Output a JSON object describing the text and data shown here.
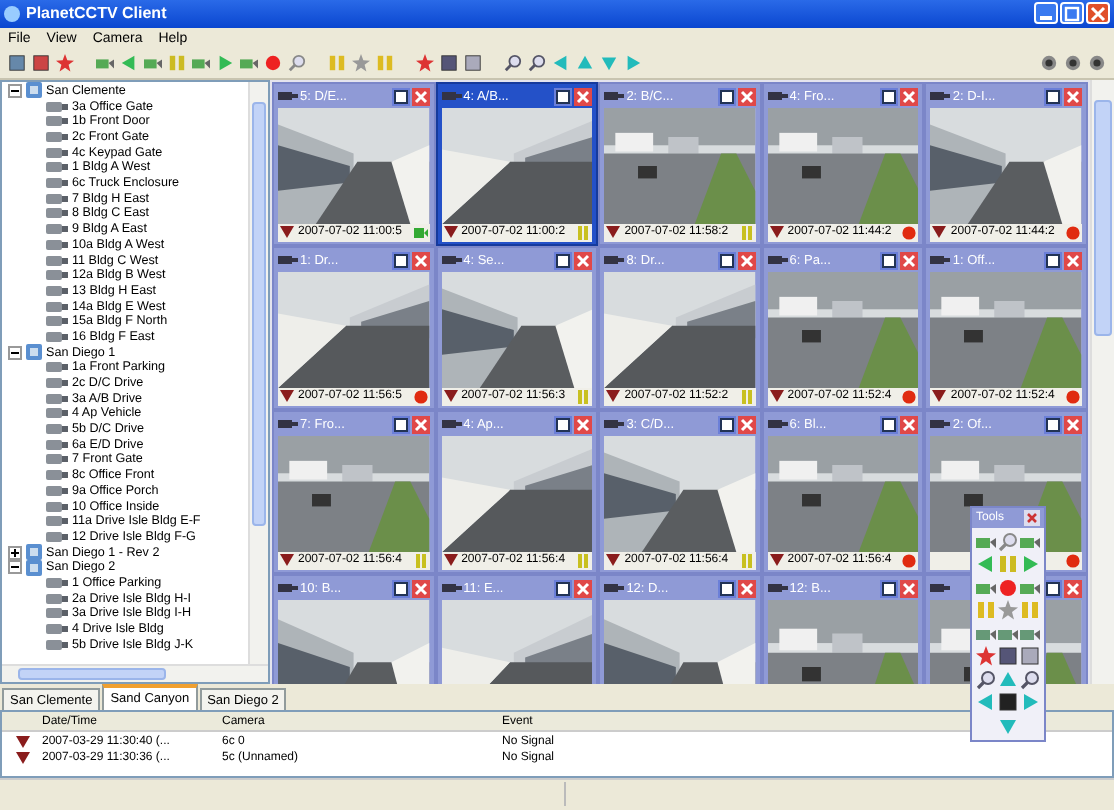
{
  "window": {
    "title": "PlanetCCTV Client"
  },
  "menu": [
    "File",
    "View",
    "Camera",
    "Help"
  ],
  "sites": [
    {
      "label": "San Clemente",
      "expanded": true,
      "children": [
        {
          "label": "3a Office Gate"
        },
        {
          "label": "1b Front Door"
        },
        {
          "label": "2c Front Gate"
        },
        {
          "label": "4c Keypad Gate"
        },
        {
          "label": "1 Bldg A West"
        },
        {
          "label": "6c Truck Enclosure"
        },
        {
          "label": "7 Bldg H East"
        },
        {
          "label": "8 Bldg C East"
        },
        {
          "label": "9 Bldg A East"
        },
        {
          "label": "10a Bldg A West"
        },
        {
          "label": "11 Bldg C West"
        },
        {
          "label": "12a Bldg B West"
        },
        {
          "label": "13 Bldg H East"
        },
        {
          "label": "14a Bldg E West"
        },
        {
          "label": "15a Bldg F North"
        },
        {
          "label": "16 Bldg F East"
        }
      ]
    },
    {
      "label": "San Diego 1",
      "expanded": true,
      "children": [
        {
          "label": "1a Front Parking"
        },
        {
          "label": "2c D/C Drive"
        },
        {
          "label": "3a A/B Drive"
        },
        {
          "label": "4 Ap Vehicle"
        },
        {
          "label": "5b D/C Drive"
        },
        {
          "label": "6a E/D Drive"
        },
        {
          "label": "7 Front Gate"
        },
        {
          "label": "8c Office Front"
        },
        {
          "label": "9a Office Porch"
        },
        {
          "label": "10 Office Inside"
        },
        {
          "label": "11a Drive Isle Bldg E-F"
        },
        {
          "label": "12 Drive Isle Bldg F-G"
        }
      ]
    },
    {
      "label": "San Diego 1 - Rev 2",
      "expanded": false
    },
    {
      "label": "San Diego 2",
      "expanded": true,
      "children": [
        {
          "label": "1 Office Parking"
        },
        {
          "label": "2a Drive Isle Bldg H-I"
        },
        {
          "label": "3a Drive Isle Bldg I-H"
        },
        {
          "label": "4 Drive Isle Bldg"
        },
        {
          "label": "5b Drive Isle Bldg J-K"
        }
      ]
    }
  ],
  "cameras": [
    {
      "title": "5: D/E...",
      "selected": false,
      "time": "2007-07-02 11:00:5",
      "recording": false,
      "paused": false
    },
    {
      "title": "4: A/B...",
      "selected": true,
      "time": "2007-07-02 11:00:2",
      "recording": false,
      "paused": true
    },
    {
      "title": "2: B/C...",
      "selected": false,
      "time": "2007-07-02 11:58:2",
      "recording": false,
      "paused": true
    },
    {
      "title": "4: Fro...",
      "selected": false,
      "time": "2007-07-02 11:44:2",
      "recording": true
    },
    {
      "title": "2: D-I...",
      "selected": false,
      "time": "2007-07-02 11:44:2",
      "recording": true
    },
    {
      "title": "1: Dr...",
      "selected": false,
      "time": "2007-07-02 11:56:5",
      "recording": true
    },
    {
      "title": "4: Se...",
      "selected": false,
      "time": "2007-07-02 11:56:3",
      "recording": false,
      "paused": true
    },
    {
      "title": "8: Dr...",
      "selected": false,
      "time": "2007-07-02 11:52:2",
      "recording": false,
      "paused": true
    },
    {
      "title": "6: Pa...",
      "selected": false,
      "time": "2007-07-02 11:52:4",
      "recording": true
    },
    {
      "title": "1: Off...",
      "selected": false,
      "time": "2007-07-02 11:52:4",
      "recording": true
    },
    {
      "title": "7: Fro...",
      "selected": false,
      "time": "2007-07-02 11:56:4",
      "recording": false,
      "paused": true
    },
    {
      "title": "4: Ap...",
      "selected": false,
      "time": "2007-07-02 11:56:4",
      "recording": false,
      "paused": true
    },
    {
      "title": "3: C/D...",
      "selected": false,
      "time": "2007-07-02 11:56:4",
      "recording": false,
      "paused": true
    },
    {
      "title": "6: Bl...",
      "selected": false,
      "time": "2007-07-02 11:56:4",
      "recording": true
    },
    {
      "title": "2: Of...",
      "selected": false,
      "recording": true
    },
    {
      "title": "10: B...",
      "selected": false
    },
    {
      "title": "11: E...",
      "selected": false
    },
    {
      "title": "12: D...",
      "selected": false
    },
    {
      "title": "12: B...",
      "selected": false
    },
    {
      "selected": false
    }
  ],
  "tabs": [
    {
      "label": "San Clemente",
      "selected": false
    },
    {
      "label": "Sand Canyon",
      "selected": true
    },
    {
      "label": "San Diego 2",
      "selected": false
    }
  ],
  "events": {
    "columns": [
      "Date/Time",
      "Camera",
      "Event"
    ],
    "rows": [
      [
        "2007-03-29 11:30:40 (...",
        "6c 0",
        "No Signal"
      ],
      [
        "2007-03-29 11:30:36 (...",
        "5c (Unnamed)",
        "No Signal"
      ]
    ]
  },
  "tools": {
    "title": "Tools"
  }
}
